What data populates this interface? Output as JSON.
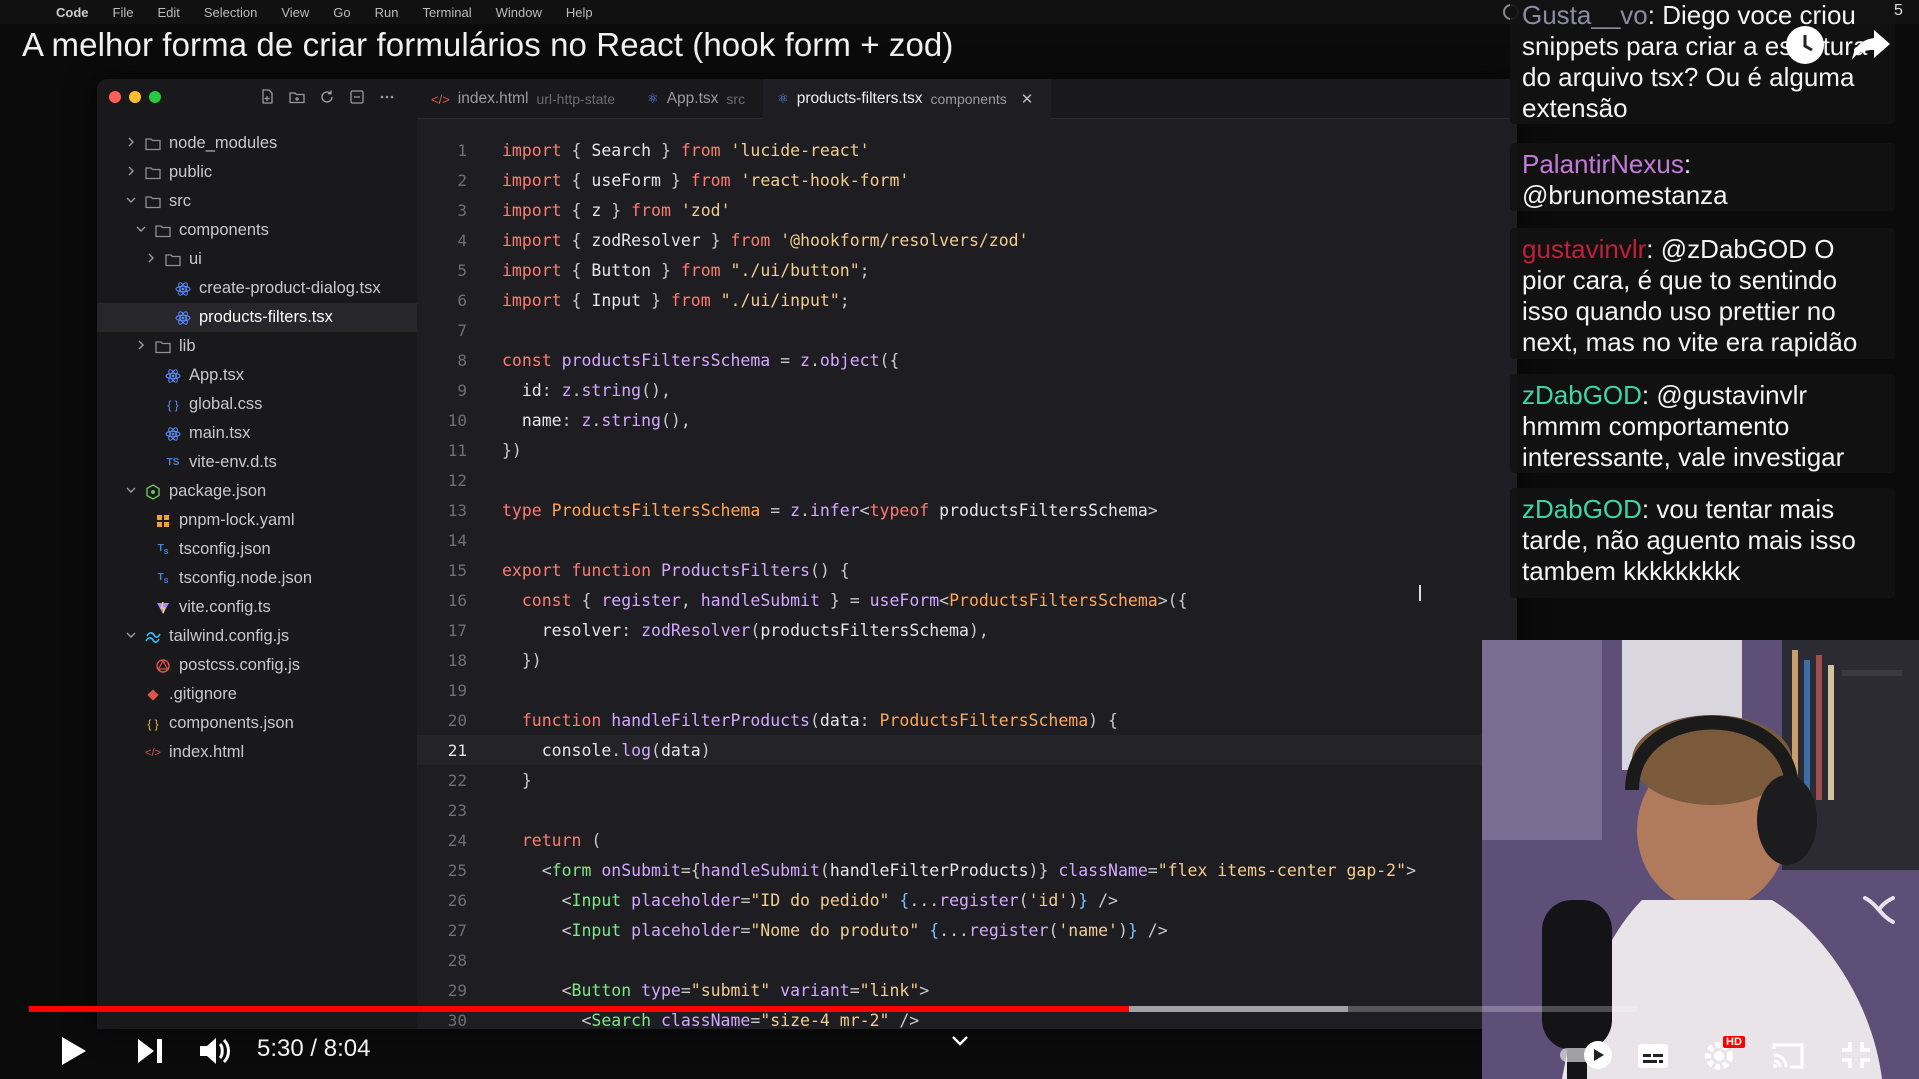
{
  "menubar": {
    "items": [
      "Code",
      "File",
      "Edit",
      "Selection",
      "View",
      "Go",
      "Run",
      "Terminal",
      "Window",
      "Help"
    ]
  },
  "video": {
    "title": "A melhor forma de criar formulários no React (hook form + zod)",
    "time": "5:30 / 8:04",
    "progress": 0.684,
    "buffered": 0.82
  },
  "ide": {
    "tabs": [
      {
        "icon": "</>",
        "name": "index.html",
        "dir": "url-http-state",
        "active": false
      },
      {
        "icon": "⚛",
        "name": "App.tsx",
        "dir": "src",
        "active": false
      },
      {
        "icon": "⚛",
        "name": "products-filters.tsx",
        "dir": "components",
        "active": true,
        "close": "✕"
      }
    ],
    "tree": [
      {
        "label": "node_modules",
        "chevron": "›",
        "icon": "folder",
        "indent": 0
      },
      {
        "label": "public",
        "chevron": "›",
        "icon": "folder",
        "indent": 0
      },
      {
        "label": "src",
        "chevron": "⌄",
        "icon": "folder",
        "indent": 0
      },
      {
        "label": "components",
        "chevron": "⌄",
        "icon": "folder",
        "indent": 1
      },
      {
        "label": "ui",
        "chevron": "›",
        "icon": "folder",
        "indent": 2
      },
      {
        "label": "create-product-dialog.tsx",
        "chevron": "",
        "icon": "react",
        "indent": 3
      },
      {
        "label": "products-filters.tsx",
        "chevron": "",
        "icon": "react",
        "indent": 3,
        "active": true
      },
      {
        "label": "lib",
        "chevron": "›",
        "icon": "folder",
        "indent": 1
      },
      {
        "label": "App.tsx",
        "chevron": "",
        "icon": "react",
        "indent": 2
      },
      {
        "label": "global.css",
        "chevron": "",
        "icon": "css",
        "indent": 2
      },
      {
        "label": "main.tsx",
        "chevron": "",
        "icon": "react",
        "indent": 2
      },
      {
        "label": "vite-env.d.ts",
        "chevron": "",
        "icon": "ts",
        "indent": 2
      },
      {
        "label": "package.json",
        "chevron": "⌄",
        "icon": "npm",
        "indent": 0
      },
      {
        "label": "pnpm-lock.yaml",
        "chevron": "",
        "icon": "yaml",
        "indent": 1
      },
      {
        "label": "tsconfig.json",
        "chevron": "",
        "icon": "tsconfig",
        "indent": 1
      },
      {
        "label": "tsconfig.node.json",
        "chevron": "",
        "icon": "tsconfig",
        "indent": 1
      },
      {
        "label": "vite.config.ts",
        "chevron": "",
        "icon": "vite",
        "indent": 1
      },
      {
        "label": "tailwind.config.js",
        "chevron": "⌄",
        "icon": "tailwind",
        "indent": 0
      },
      {
        "label": "postcss.config.js",
        "chevron": "",
        "icon": "postcss",
        "indent": 1
      },
      {
        "label": ".gitignore",
        "chevron": "",
        "icon": "git",
        "indent": 0
      },
      {
        "label": "components.json",
        "chevron": "",
        "icon": "json",
        "indent": 0
      },
      {
        "label": "index.html",
        "chevron": "",
        "icon": "html",
        "indent": 0
      }
    ],
    "current_line": 21,
    "code": [
      [
        [
          "kw",
          "import"
        ],
        [
          "pn",
          " { "
        ],
        [
          "id",
          "Search"
        ],
        [
          "pn",
          " } "
        ],
        [
          "kw",
          "from"
        ],
        [
          "str",
          " 'lucide-react'"
        ]
      ],
      [
        [
          "kw",
          "import"
        ],
        [
          "pn",
          " { "
        ],
        [
          "id",
          "useForm"
        ],
        [
          "pn",
          " } "
        ],
        [
          "kw",
          "from"
        ],
        [
          "str",
          " 'react-hook-form'"
        ]
      ],
      [
        [
          "kw",
          "import"
        ],
        [
          "pn",
          " { "
        ],
        [
          "id",
          "z"
        ],
        [
          "pn",
          " } "
        ],
        [
          "kw",
          "from"
        ],
        [
          "str",
          " 'zod'"
        ]
      ],
      [
        [
          "kw",
          "import"
        ],
        [
          "pn",
          " { "
        ],
        [
          "id",
          "zodResolver"
        ],
        [
          "pn",
          " } "
        ],
        [
          "kw",
          "from"
        ],
        [
          "str",
          " '@hookform/resolvers/zod'"
        ]
      ],
      [
        [
          "kw",
          "import"
        ],
        [
          "pn",
          " { "
        ],
        [
          "id",
          "Button"
        ],
        [
          "pn",
          " } "
        ],
        [
          "kw",
          "from"
        ],
        [
          "str",
          " \"./ui/button\""
        ],
        [
          "pn",
          ";"
        ]
      ],
      [
        [
          "kw",
          "import"
        ],
        [
          "pn",
          " { "
        ],
        [
          "id",
          "Input"
        ],
        [
          "pn",
          " } "
        ],
        [
          "kw",
          "from"
        ],
        [
          "str",
          " \"./ui/input\""
        ],
        [
          "pn",
          ";"
        ]
      ],
      [],
      [
        [
          "kw",
          "const"
        ],
        [
          "fn",
          " productsFiltersSchema"
        ],
        [
          "pn",
          " = "
        ],
        [
          "fn",
          "z"
        ],
        [
          "pn",
          "."
        ],
        [
          "fn",
          "object"
        ],
        [
          "pn",
          "({"
        ]
      ],
      [
        [
          "prop",
          "  id"
        ],
        [
          "pn",
          ": "
        ],
        [
          "fn",
          "z"
        ],
        [
          "pn",
          "."
        ],
        [
          "fn",
          "string"
        ],
        [
          "pn",
          "(),"
        ]
      ],
      [
        [
          "prop",
          "  name"
        ],
        [
          "pn",
          ": "
        ],
        [
          "fn",
          "z"
        ],
        [
          "pn",
          "."
        ],
        [
          "fn",
          "string"
        ],
        [
          "pn",
          "(),"
        ]
      ],
      [
        [
          "pn",
          "})"
        ]
      ],
      [],
      [
        [
          "kw",
          "type"
        ],
        [
          "ty",
          " ProductsFiltersSchema"
        ],
        [
          "pn",
          " = "
        ],
        [
          "fn",
          "z"
        ],
        [
          "pn",
          "."
        ],
        [
          "fn",
          "infer"
        ],
        [
          "pn",
          "<"
        ],
        [
          "kw",
          "typeof"
        ],
        [
          "id",
          " productsFiltersSchema"
        ],
        [
          "pn",
          ">"
        ]
      ],
      [],
      [
        [
          "kw",
          "export function"
        ],
        [
          "fn",
          " ProductsFilters"
        ],
        [
          "pn",
          "() {"
        ]
      ],
      [
        [
          "kw",
          "  const"
        ],
        [
          "pn",
          " { "
        ],
        [
          "fn",
          "register"
        ],
        [
          "pn",
          ", "
        ],
        [
          "fn",
          "handleSubmit"
        ],
        [
          "pn",
          " } = "
        ],
        [
          "fn",
          "useForm"
        ],
        [
          "pn",
          "<"
        ],
        [
          "ty",
          "ProductsFiltersSchema"
        ],
        [
          "pn",
          ">({"
        ]
      ],
      [
        [
          "prop",
          "    resolver"
        ],
        [
          "pn",
          ": "
        ],
        [
          "fn",
          "zodResolver"
        ],
        [
          "pn",
          "("
        ],
        [
          "id",
          "productsFiltersSchema"
        ],
        [
          "pn",
          "),"
        ]
      ],
      [
        [
          "pn",
          "  })"
        ]
      ],
      [],
      [
        [
          "kw",
          "  function"
        ],
        [
          "fn",
          " handleFilterProducts"
        ],
        [
          "pn",
          "("
        ],
        [
          "id",
          "data"
        ],
        [
          "pn",
          ": "
        ],
        [
          "ty",
          "ProductsFiltersSchema"
        ],
        [
          "pn",
          ") {"
        ]
      ],
      [
        [
          "id",
          "    console"
        ],
        [
          "pn",
          "."
        ],
        [
          "fn",
          "log"
        ],
        [
          "pn",
          "("
        ],
        [
          "id",
          "data"
        ],
        [
          "pn",
          ")"
        ]
      ],
      [
        [
          "pn",
          "  }"
        ]
      ],
      [],
      [
        [
          "kw",
          "  return"
        ],
        [
          "pn",
          " ("
        ]
      ],
      [
        [
          "pn",
          "    <"
        ],
        [
          "tag",
          "form"
        ],
        [
          "attr",
          " onSubmit"
        ],
        [
          "pn",
          "={"
        ],
        [
          "fn",
          "handleSubmit"
        ],
        [
          "pn",
          "("
        ],
        [
          "id",
          "handleFilterProducts"
        ],
        [
          "pn",
          ")}"
        ],
        [
          "attr",
          " className"
        ],
        [
          "pn",
          "="
        ],
        [
          "str",
          "\"flex items-center gap-2\""
        ],
        [
          "pn",
          ">"
        ]
      ],
      [
        [
          "pn",
          "      <"
        ],
        [
          "tag",
          "Input"
        ],
        [
          "attr",
          " placeholder"
        ],
        [
          "pn",
          "="
        ],
        [
          "str",
          "\"ID do pedido\""
        ],
        [
          "br",
          " {"
        ],
        [
          "pn",
          "..."
        ],
        [
          "fn",
          "register"
        ],
        [
          "pn",
          "("
        ],
        [
          "str",
          "'id'"
        ],
        [
          "pn",
          ")"
        ],
        [
          "br",
          "}"
        ],
        [
          "pn",
          " />"
        ]
      ],
      [
        [
          "pn",
          "      <"
        ],
        [
          "tag",
          "Input"
        ],
        [
          "attr",
          " placeholder"
        ],
        [
          "pn",
          "="
        ],
        [
          "str",
          "\"Nome do produto\""
        ],
        [
          "br",
          " {"
        ],
        [
          "pn",
          "..."
        ],
        [
          "fn",
          "register"
        ],
        [
          "pn",
          "("
        ],
        [
          "str",
          "'name'"
        ],
        [
          "pn",
          ")"
        ],
        [
          "br",
          "}"
        ],
        [
          "pn",
          " />"
        ]
      ],
      [],
      [
        [
          "pn",
          "      <"
        ],
        [
          "tag",
          "Button"
        ],
        [
          "attr",
          " type"
        ],
        [
          "pn",
          "="
        ],
        [
          "str",
          "\"submit\""
        ],
        [
          "attr",
          " variant"
        ],
        [
          "pn",
          "="
        ],
        [
          "str",
          "\"link\""
        ],
        [
          "pn",
          ">"
        ]
      ],
      [
        [
          "pn",
          "        <"
        ],
        [
          "tag",
          "Search"
        ],
        [
          "attr",
          " className"
        ],
        [
          "pn",
          "="
        ],
        [
          "str",
          "\"size-4 mr-2\""
        ],
        [
          "pn",
          " />"
        ]
      ]
    ]
  },
  "chat": [
    {
      "user": "Gusta__vo",
      "user_color": "#8d8aa6",
      "text": "Diego voce criou snippets para criar a estrutura do arquivo tsx? Ou é alguma extensão"
    },
    {
      "user": "PalantirNexus",
      "user_color": "#c27bd9",
      "text": "@brunomestanza"
    },
    {
      "user": "gustavinvlr",
      "user_color": "#c0203a",
      "text": "@zDabGOD O pior cara, é que to sentindo isso quando uso prettier no next, mas no vite era rapidão"
    },
    {
      "user": "zDabGOD",
      "user_color": "#3dd6a8",
      "text": "@gustavinvlr hmmm comportamento interessante, vale investigar"
    },
    {
      "user": "zDabGOD",
      "user_color": "#3dd6a8",
      "text": "vou tentar mais tarde, não aguento mais isso tambem kkkkkkkkk"
    }
  ],
  "corner_label": "5",
  "controls": {
    "hd_badge": "HD"
  }
}
